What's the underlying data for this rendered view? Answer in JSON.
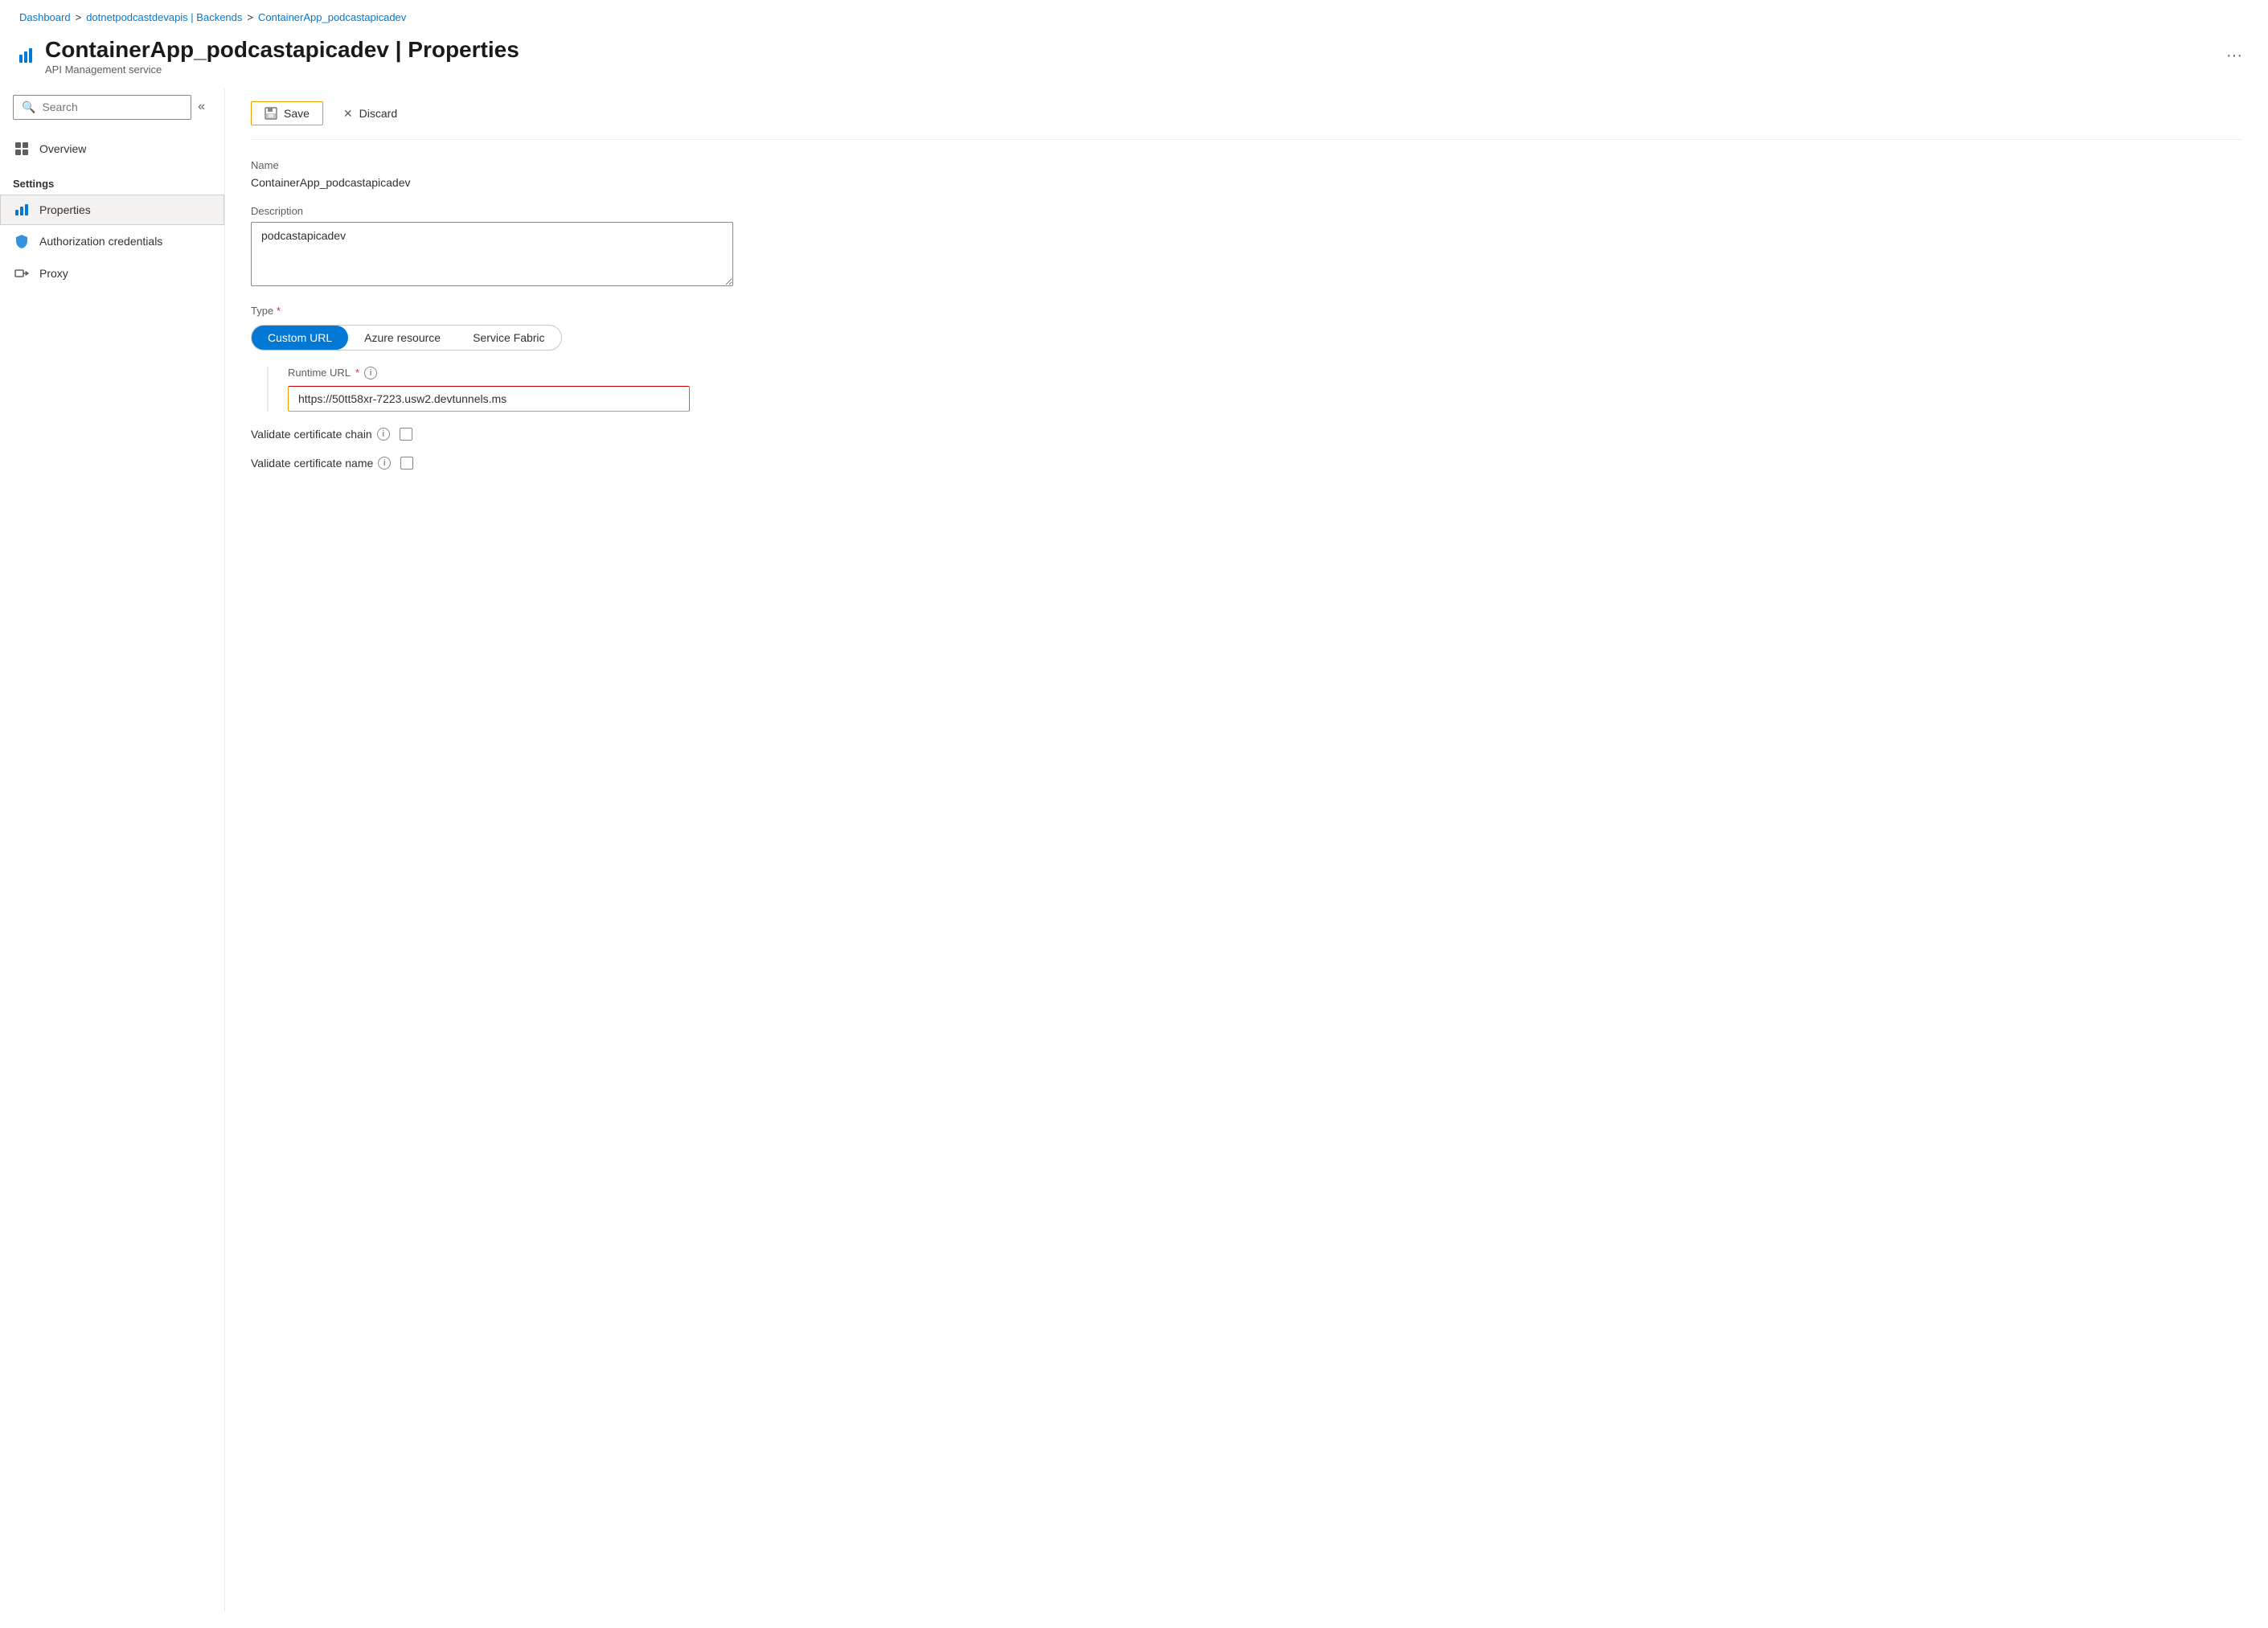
{
  "breadcrumb": {
    "items": [
      {
        "label": "Dashboard",
        "link": true
      },
      {
        "label": "dotnetpodcastdevapis | Backends",
        "link": true
      },
      {
        "label": "ContainerApp_podcastapicadev",
        "link": true
      }
    ],
    "separator": ">"
  },
  "header": {
    "title": "ContainerApp_podcastapicadev | Properties",
    "subtitle": "API Management service",
    "more_label": "···"
  },
  "sidebar": {
    "search_placeholder": "Search",
    "collapse_label": "«",
    "items": [
      {
        "id": "overview",
        "label": "Overview",
        "icon": "overview-icon"
      },
      {
        "id": "settings-section",
        "label": "Settings",
        "is_section": true
      },
      {
        "id": "properties",
        "label": "Properties",
        "icon": "bars-icon",
        "active": true
      },
      {
        "id": "auth-credentials",
        "label": "Authorization credentials",
        "icon": "shield-icon",
        "active": false
      },
      {
        "id": "proxy",
        "label": "Proxy",
        "icon": "proxy-icon",
        "active": false
      }
    ]
  },
  "toolbar": {
    "save_label": "Save",
    "discard_label": "Discard"
  },
  "form": {
    "name_label": "Name",
    "name_value": "ContainerApp_podcastapicadev",
    "description_label": "Description",
    "description_value": "podcastapicadev",
    "type_label": "Type",
    "type_required": true,
    "type_options": [
      {
        "id": "custom-url",
        "label": "Custom URL",
        "selected": true
      },
      {
        "id": "azure-resource",
        "label": "Azure resource",
        "selected": false
      },
      {
        "id": "service-fabric",
        "label": "Service Fabric",
        "selected": false
      }
    ],
    "runtime_url_label": "Runtime URL",
    "runtime_url_required": true,
    "runtime_url_value": "https://50tt58xr-7223.usw2.devtunnels.ms",
    "validate_cert_chain_label": "Validate certificate chain",
    "validate_cert_name_label": "Validate certificate name"
  },
  "icons": {
    "search": "🔍",
    "overview": "⬜",
    "shield": "🛡",
    "proxy": "↪",
    "save": "💾",
    "discard": "✕",
    "info": "i",
    "bars": "|||"
  }
}
